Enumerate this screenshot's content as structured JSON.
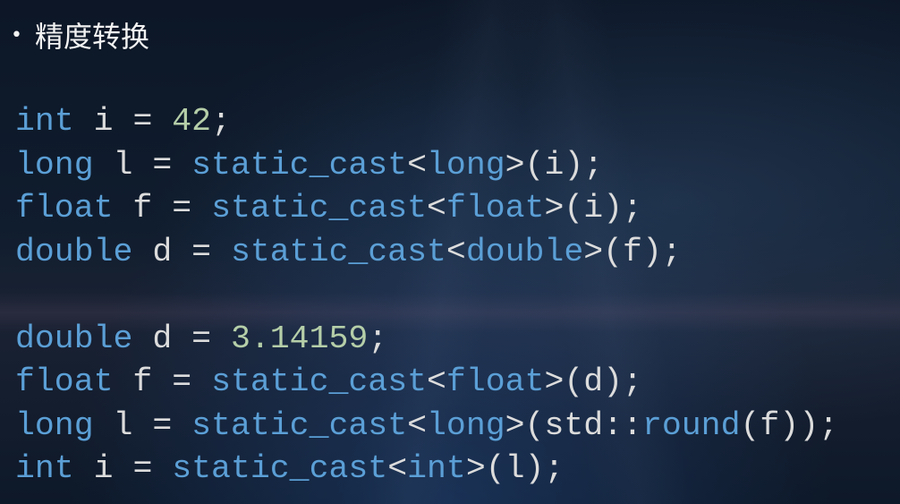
{
  "slide": {
    "bullet": "•",
    "title": "精度转换",
    "code_lines": [
      [
        [
          "int",
          "kw"
        ],
        [
          " i ",
          "id"
        ],
        [
          "= ",
          "id"
        ],
        [
          "42",
          "num"
        ],
        [
          ";",
          "id"
        ]
      ],
      [
        [
          "long",
          "kw"
        ],
        [
          " l ",
          "id"
        ],
        [
          "= ",
          "id"
        ],
        [
          "static_cast",
          "kw"
        ],
        [
          "<",
          "id"
        ],
        [
          "long",
          "kw"
        ],
        [
          ">(i);",
          "id"
        ]
      ],
      [
        [
          "float",
          "kw"
        ],
        [
          " f ",
          "id"
        ],
        [
          "= ",
          "id"
        ],
        [
          "static_cast",
          "kw"
        ],
        [
          "<",
          "id"
        ],
        [
          "float",
          "kw"
        ],
        [
          ">(i);",
          "id"
        ]
      ],
      [
        [
          "double",
          "kw"
        ],
        [
          " d ",
          "id"
        ],
        [
          "= ",
          "id"
        ],
        [
          "static_cast",
          "kw"
        ],
        [
          "<",
          "id"
        ],
        [
          "double",
          "kw"
        ],
        [
          ">(f);",
          "id"
        ]
      ],
      [],
      [
        [
          "double",
          "kw"
        ],
        [
          " d ",
          "id"
        ],
        [
          "= ",
          "id"
        ],
        [
          "3.14159",
          "num"
        ],
        [
          ";",
          "id"
        ]
      ],
      [
        [
          "float",
          "kw"
        ],
        [
          " f ",
          "id"
        ],
        [
          "= ",
          "id"
        ],
        [
          "static_cast",
          "kw"
        ],
        [
          "<",
          "id"
        ],
        [
          "float",
          "kw"
        ],
        [
          ">(d);",
          "id"
        ]
      ],
      [
        [
          "long",
          "kw"
        ],
        [
          " l ",
          "id"
        ],
        [
          "= ",
          "id"
        ],
        [
          "static_cast",
          "kw"
        ],
        [
          "<",
          "id"
        ],
        [
          "long",
          "kw"
        ],
        [
          ">(std::",
          "id"
        ],
        [
          "round",
          "kw"
        ],
        [
          "(f));",
          "id"
        ]
      ],
      [
        [
          "int",
          "kw"
        ],
        [
          " i ",
          "id"
        ],
        [
          "= ",
          "id"
        ],
        [
          "static_cast",
          "kw"
        ],
        [
          "<",
          "id"
        ],
        [
          "int",
          "kw"
        ],
        [
          ">(l);",
          "id"
        ]
      ]
    ]
  },
  "colors": {
    "keyword": "#5b9fd6",
    "number": "#b5cea8",
    "text": "#dcdcdc",
    "background": "#0f1b2b"
  }
}
